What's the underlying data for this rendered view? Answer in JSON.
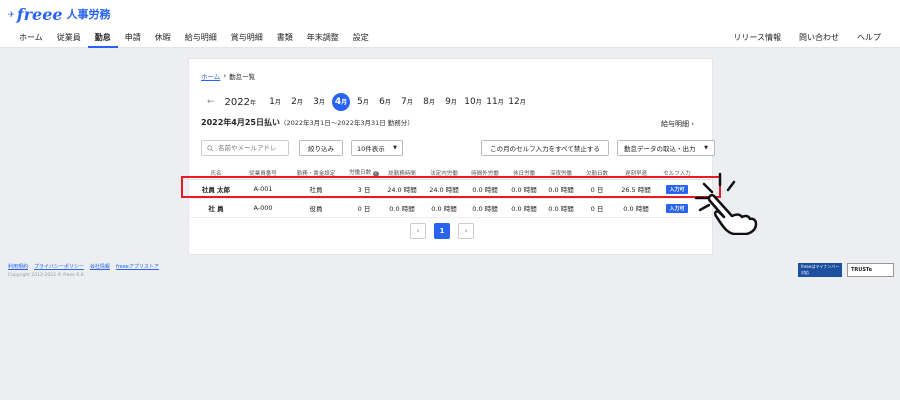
{
  "header": {
    "logo_word": "freee",
    "logo_product": "人事労務",
    "nav": [
      "ホーム",
      "従業員",
      "勤怠",
      "申請",
      "休暇",
      "給与明細",
      "賞与明細",
      "書類",
      "年末調整",
      "設定"
    ],
    "nav_right": [
      "リリース情報",
      "問い合わせ",
      "ヘルプ"
    ]
  },
  "breadcrumb": {
    "home": "ホーム",
    "current": "勤怠一覧"
  },
  "months": {
    "year": "2022",
    "year_unit": "年",
    "month_unit": "月",
    "items": [
      "1",
      "2",
      "3",
      "4",
      "5",
      "6",
      "7",
      "8",
      "9",
      "10",
      "11",
      "12"
    ],
    "active": "4"
  },
  "pay": {
    "title": "2022年4月25日払い",
    "note": "（2022年3月1日～2022年3月31日 勤務分）",
    "payslip_link": "給与明細"
  },
  "controls": {
    "search_placeholder": "名前やメールアドレ",
    "filter_label": "絞り込み",
    "page_size": "10件表示",
    "lock_label": "この月のセルフ入力をすべて禁止する",
    "import_label": "勤怠データの取込・出力"
  },
  "table": {
    "headers": [
      "氏名",
      "従業員番号",
      "勤務・賃金設定",
      "労働日数",
      "総勤務時間",
      "法定内労働",
      "時間外労働",
      "休日労働",
      "深夜労働",
      "欠勤日数",
      "遅刻早退",
      "セルフ入力"
    ],
    "rows": [
      {
        "name": "社員 太郎",
        "number": "A-001",
        "setting": "社員",
        "days": "3 日",
        "total": "24.0 時間",
        "legal": "24.0 時間",
        "overtime": "0.0 時間",
        "holiday": "0.0 時間",
        "night": "0.0 時間",
        "absent": "0 日",
        "late": "26.5 時間",
        "self": "入力可"
      },
      {
        "name": "社 員",
        "number": "A-000",
        "setting": "役員",
        "days": "0 日",
        "total": "0.0 時間",
        "legal": "0.0 時間",
        "overtime": "0.0 時間",
        "holiday": "0.0 時間",
        "night": "0.0 時間",
        "absent": "0 日",
        "late": "0.0 時間",
        "self": "入力可"
      }
    ]
  },
  "pager": {
    "prev": "‹",
    "current": "1",
    "next": "›"
  },
  "footer": {
    "links": [
      "利用規約",
      "プライバシーポリシー",
      "会社情報",
      "freeeアプリストア"
    ],
    "copyright": "Copyright 2012-2022 © freee K.K.",
    "mynumber_badge": "freeeはマイナンバー対応",
    "truste_badge": "TRUSTe"
  },
  "colors": {
    "accent": "#2864f0",
    "highlight": "#e81b24"
  }
}
